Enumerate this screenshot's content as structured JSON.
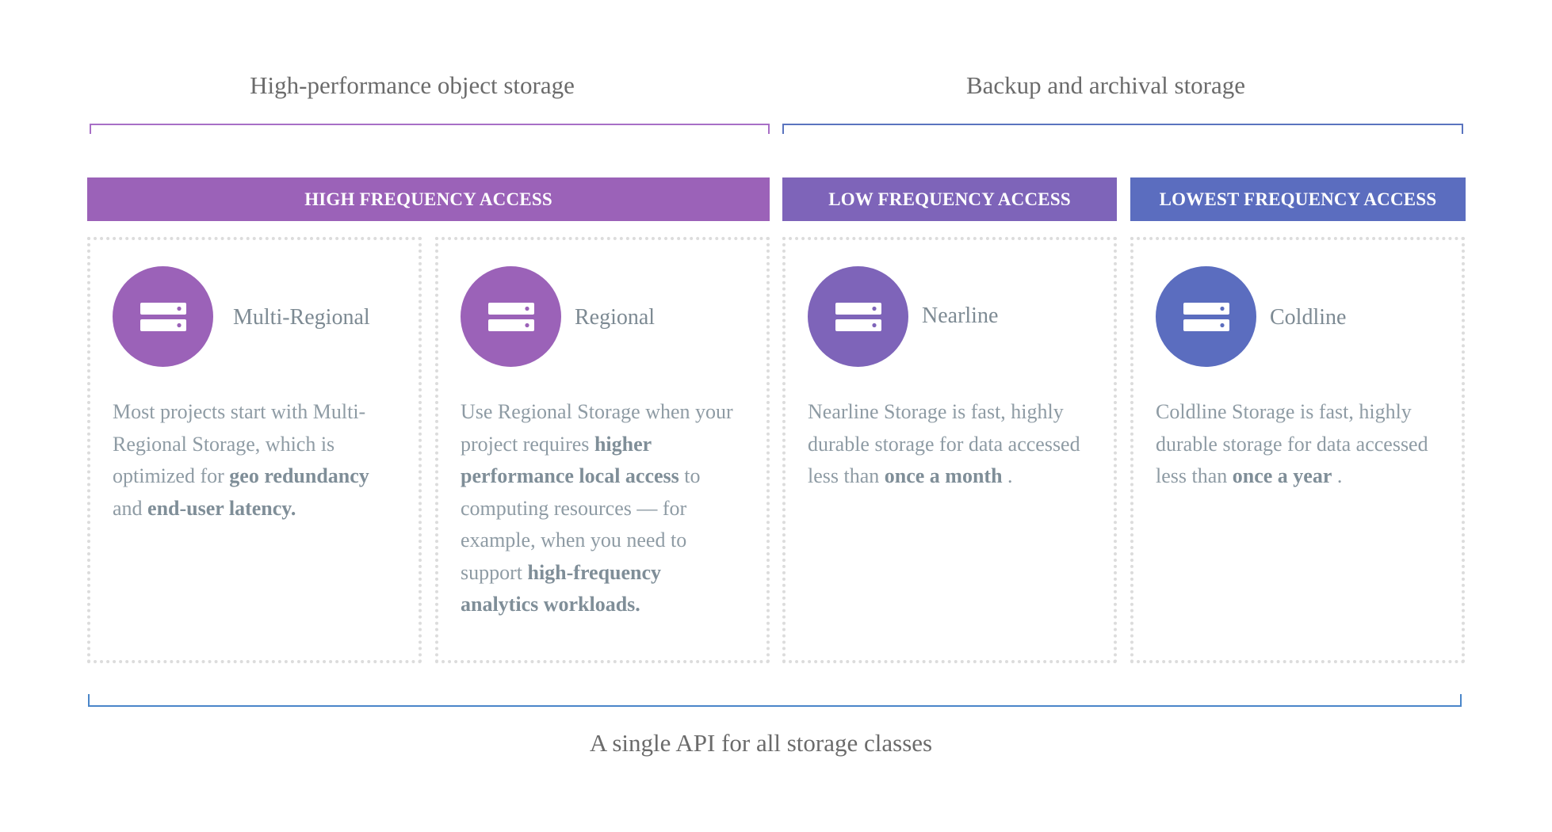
{
  "groups": {
    "performance_title": "High-performance object storage",
    "backup_title": "Backup and archival storage"
  },
  "banners": {
    "high": "HIGH FREQUENCY ACCESS",
    "low": "LOW FREQUENCY ACCESS",
    "lowest": "LOWEST FREQUENCY ACCESS"
  },
  "colors": {
    "high": "#9b62b8",
    "low": "#7e64b9",
    "lowest": "#5b6dbf",
    "bracket_performance": "#a86fc6",
    "bracket_backup": "#5a74bf",
    "bracket_api": "#4a86c9"
  },
  "cards": [
    {
      "name": "Multi-Regional",
      "icon": "storage-server-icon",
      "desc": [
        {
          "t": "Most projects start with Multi-Regional Storage, which is optimized for ",
          "b": false
        },
        {
          "t": "geo redundancy",
          "b": true
        },
        {
          "t": " and ",
          "b": false
        },
        {
          "t": "end-user latency.",
          "b": true
        }
      ]
    },
    {
      "name": "Regional",
      "icon": "storage-server-icon",
      "desc": [
        {
          "t": "Use Regional Storage when your project requires ",
          "b": false
        },
        {
          "t": "higher performance local access",
          "b": true
        },
        {
          "t": " to computing resources — for example, when you need to support ",
          "b": false
        },
        {
          "t": "high-frequency analytics workloads.",
          "b": true
        }
      ]
    },
    {
      "name": "Nearline",
      "icon": "storage-server-icon",
      "desc": [
        {
          "t": "Nearline Storage is fast, highly durable storage for data accessed less than ",
          "b": false
        },
        {
          "t": "once a month",
          "b": true
        },
        {
          "t": " .",
          "b": false
        }
      ]
    },
    {
      "name": "Coldline",
      "icon": "storage-server-icon",
      "desc": [
        {
          "t": "Coldline Storage is fast, highly durable storage for data accessed less than ",
          "b": false
        },
        {
          "t": "once a year",
          "b": true
        },
        {
          "t": " .",
          "b": false
        }
      ]
    }
  ],
  "footer": {
    "title": "A single API for all storage classes"
  }
}
